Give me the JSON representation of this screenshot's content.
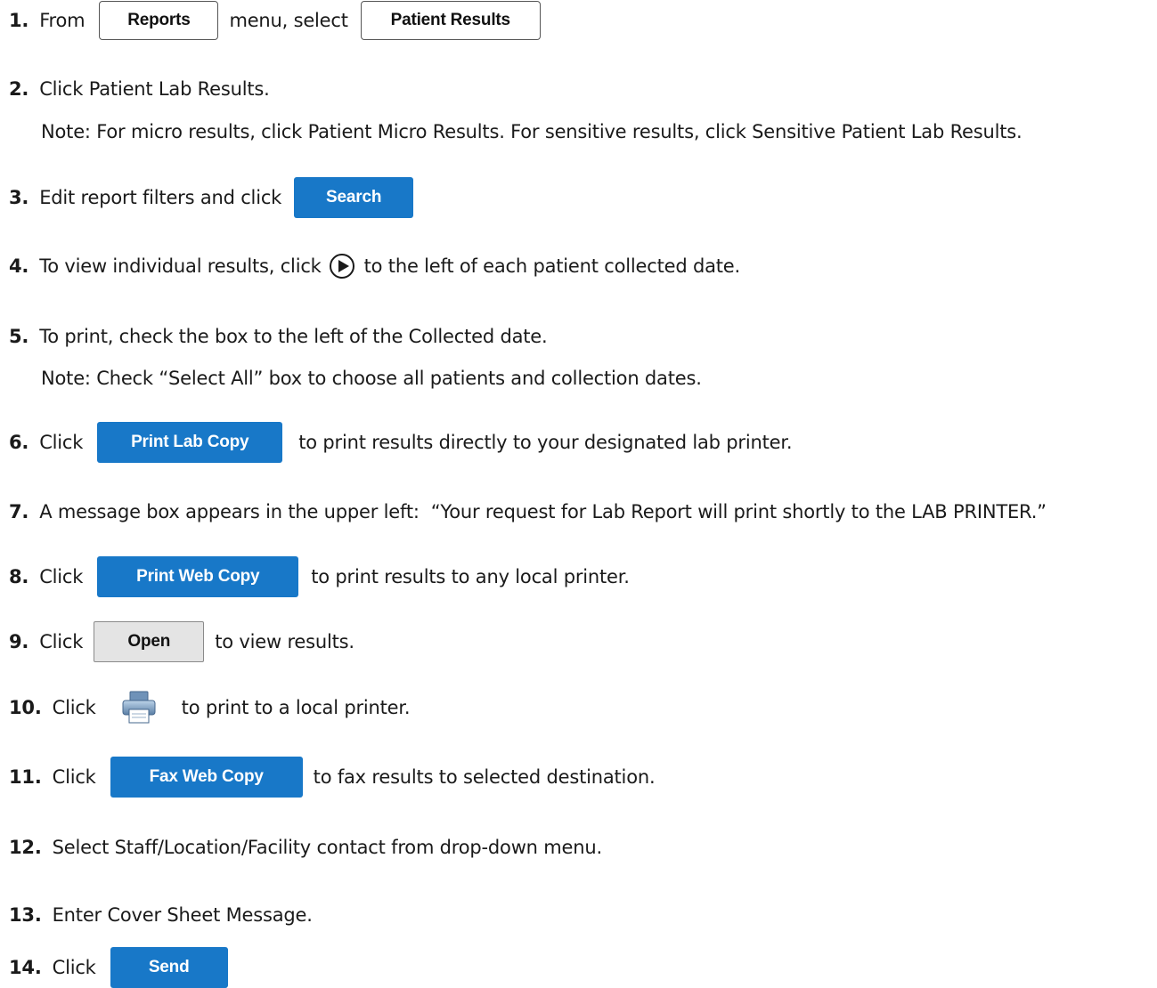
{
  "steps": {
    "s1": {
      "num": "1.",
      "a": "From",
      "reports_btn": "Reports",
      "b": "menu, select",
      "patient_results_btn": "Patient Results"
    },
    "s2": {
      "num": "2.",
      "text": "Click Patient Lab Results.",
      "note": "Note: For micro results, click Patient Micro Results.  For sensitive results, click Sensitive Patient Lab Results."
    },
    "s3": {
      "num": "3.",
      "text": "Edit report filters and click",
      "search_btn": "Search"
    },
    "s4": {
      "num": "4.",
      "a": "To view individual results, click",
      "b": "to the left of each patient collected date."
    },
    "s5": {
      "num": "5.",
      "text": "To print, check the box to the left of the Collected date.",
      "note": "Note: Check “Select All” box to choose all patients and collection dates."
    },
    "s6": {
      "num": "6.",
      "a": "Click",
      "btn": "Print Lab Copy",
      "b": "to print results directly to your designated lab printer."
    },
    "s7": {
      "num": "7.",
      "text": "A message box appears in the upper left:  “Your request for Lab Report will print shortly to the LAB PRINTER.”"
    },
    "s8": {
      "num": "8.",
      "a": "Click",
      "btn": "Print Web Copy",
      "b": "to print results to any local printer."
    },
    "s9": {
      "num": "9.",
      "a": "Click",
      "btn": "Open",
      "b": "to view results."
    },
    "s10": {
      "num": "10.",
      "a": "Click",
      "b": "to print to a local printer."
    },
    "s11": {
      "num": "11.",
      "a": "Click",
      "btn": "Fax Web Copy",
      "b": "to fax results to selected destination."
    },
    "s12": {
      "num": "12.",
      "text": "Select Staff/Location/Facility contact from drop-down menu."
    },
    "s13": {
      "num": "13.",
      "text": "Enter Cover Sheet Message."
    },
    "s14": {
      "num": "14.",
      "a": "Click",
      "btn": "Send"
    }
  },
  "colors": {
    "button_blue": "#1878c8",
    "button_gray": "#e4e4e4"
  },
  "icons": {
    "play": "play-circle-icon",
    "printer": "printer-icon"
  }
}
